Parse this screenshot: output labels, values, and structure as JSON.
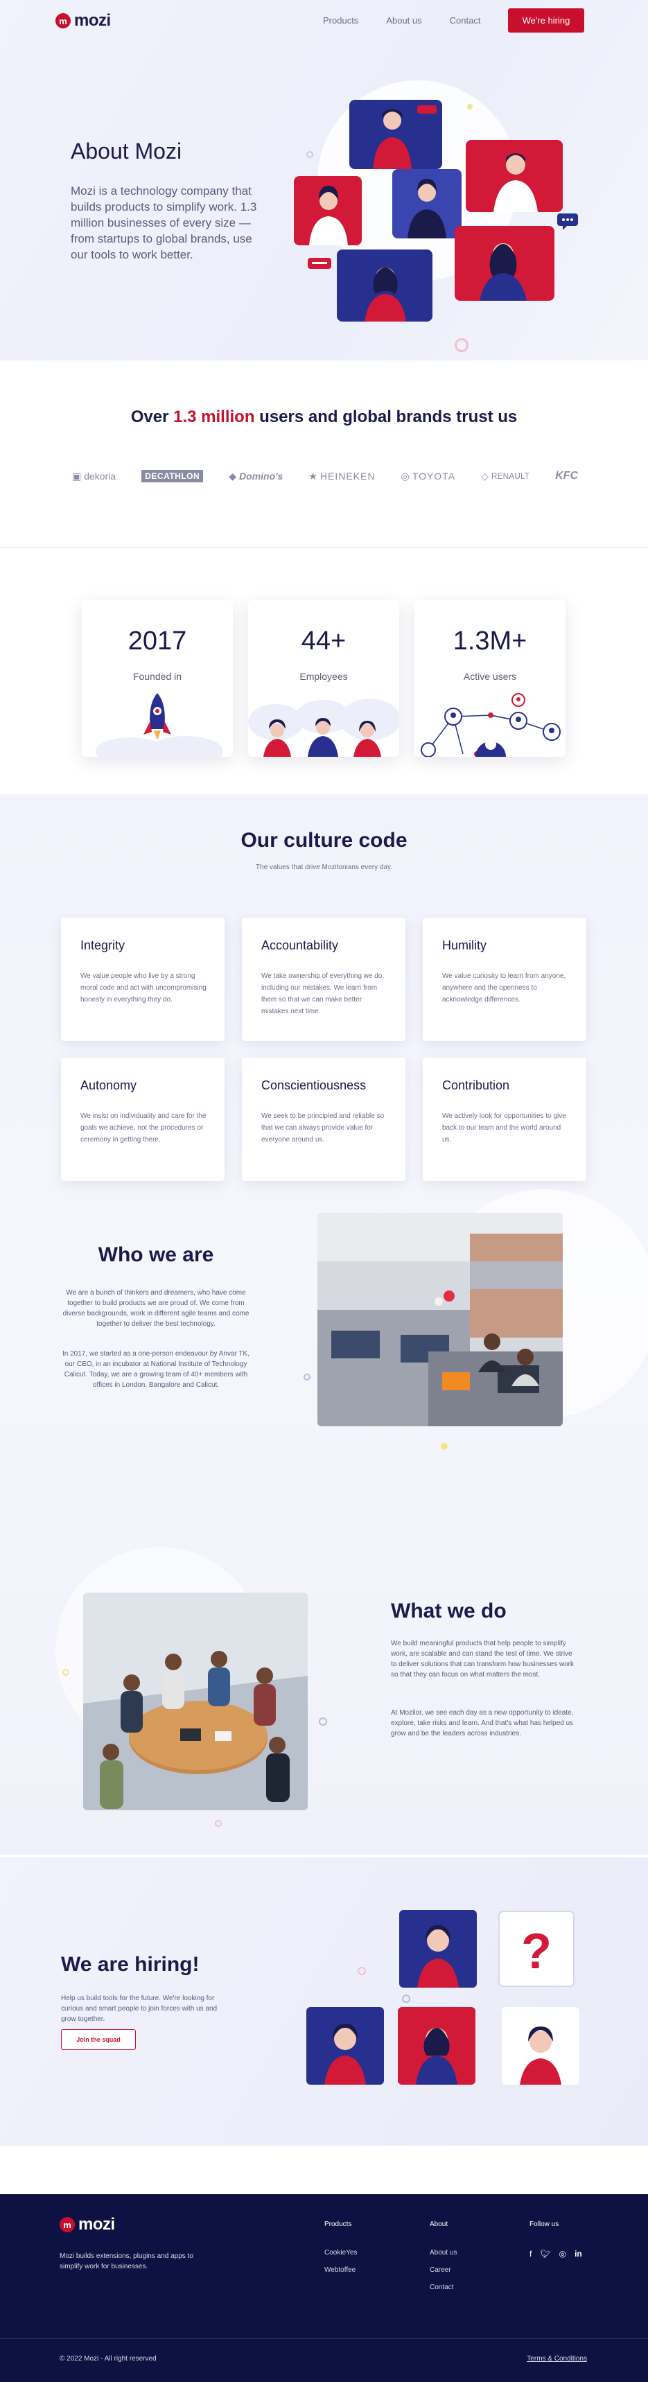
{
  "colors": {
    "brand_red": "#c8102e",
    "navy": "#1a1b4b",
    "footer_bg": "#0e1242"
  },
  "header": {
    "logo_mark": "m",
    "logo_text": "mozi",
    "nav": [
      {
        "label": "Products"
      },
      {
        "label": "About us"
      },
      {
        "label": "Contact"
      }
    ],
    "cta": "We're hiring"
  },
  "hero": {
    "title": "About Mozi",
    "text": "Mozi is a technology company that builds products to simplify work. 1.3 million businesses of every size — from startups to global brands, use our tools to work better."
  },
  "trust": {
    "title_pre": "Over ",
    "title_highlight": "1.3 million",
    "title_post": " users and global brands trust us",
    "brands": [
      "dekoria",
      "DECATHLON",
      "Domino's",
      "HEINEKEN",
      "TOYOTA",
      "RENAULT",
      "KFC"
    ]
  },
  "stats": [
    {
      "value": "2017",
      "label": "Founded in",
      "art": "rocket-icon"
    },
    {
      "value": "44+",
      "label": "Employees",
      "art": "people-icon"
    },
    {
      "value": "1.3M+",
      "label": "Active users",
      "art": "network-icon"
    }
  ],
  "culture": {
    "title": "Our culture code",
    "subtitle": "The values that drive Mozitonians every day.",
    "values": [
      {
        "title": "Integrity",
        "text": "We value people who live by a strong moral code and act with uncompromising honesty in everything they do."
      },
      {
        "title": "Accountability",
        "text": "We take ownership of everything we do, including our mistakes. We learn from them so that we can make better mistakes next time."
      },
      {
        "title": "Humility",
        "text": "We value curiosity to learn from anyone, anywhere and the openness to acknowledge differences."
      },
      {
        "title": "Autonomy",
        "text": "We insist on individuality and care for the goals we achieve, not the procedures or ceremony in getting there."
      },
      {
        "title": "Conscientiousness",
        "text": "We seek to be principled and reliable so that we can always provide value for everyone around us."
      },
      {
        "title": "Contribution",
        "text": "We actively look for opportunities to give back to our team and the world around us."
      }
    ]
  },
  "who": {
    "title": "Who we are",
    "p1": "We are a bunch of thinkers and dreamers, who have come together to build products we are proud of. We come from diverse backgrounds, work in different agile teams and come together to deliver the best technology.",
    "p2": "In 2017, we started as a one-person endeavour by Anvar TK, our CEO, in an incubator at National Institute of Technology Calicut. Today, we are a growing team of 40+ members with offices in London, Bangalore and Calicut."
  },
  "what": {
    "title": "What we do",
    "p1": "We build meaningful products that help people to simplify work, are scalable and can stand the test of time. We strive to deliver solutions that can transform how businesses work so that they can focus on what matters the most.",
    "p2": "At Mozilor, we see each day as a new opportunity to ideate, explore, take risks and learn. And that's what has helped us grow and be the leaders across industries."
  },
  "hiring": {
    "title": "We are hiring!",
    "text": "Help us build tools for the future. We're looking for curious and smart people to join forces with us and grow together.",
    "button": "Join the squad"
  },
  "footer": {
    "logo_text": "mozi",
    "description": "Mozi builds extensions, plugins and apps to simplify work for businesses.",
    "products_heading": "Products",
    "products": [
      "CookieYes",
      "Webtoffee"
    ],
    "about_heading": "About",
    "about": [
      "About us",
      "Career",
      "Contact"
    ],
    "follow_heading": "Follow us",
    "social": [
      "f",
      "t",
      "ig",
      "in"
    ],
    "copyright": "© 2022 Mozi - All right reserved",
    "terms": "Terms & Conditions"
  }
}
